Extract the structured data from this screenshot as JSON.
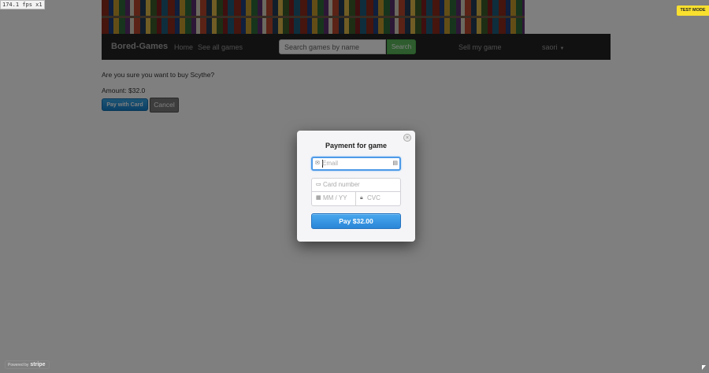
{
  "debug": {
    "fps_label": "174.1 fps x1"
  },
  "navbar": {
    "brand": "Bored-Games",
    "links": [
      "Home",
      "See all games"
    ],
    "search_placeholder": "Search games by name",
    "search_button": "Search",
    "sell_link": "Sell my game",
    "user_menu": "saori"
  },
  "purchase": {
    "question": "Are you sure you want to buy Scythe?",
    "amount": "Amount: $32.0",
    "pay_button": "Pay with Card",
    "cancel_button": "Cancel"
  },
  "checkout": {
    "title": "Payment for game",
    "email_placeholder": "Email",
    "card_number_placeholder": "Card number",
    "expiry_placeholder": "MM / YY",
    "cvc_placeholder": "CVC",
    "pay_button": "Pay $32.00",
    "test_mode_badge": "TEST MODE",
    "powered_by": "Powered by",
    "stripe": "stripe"
  },
  "icons": {
    "close": "close-icon",
    "email": "envelope-icon",
    "autofill": "contact-card-icon",
    "card": "credit-card-icon",
    "calendar": "calendar-icon",
    "lock": "lock-icon"
  },
  "colors": {
    "navbar": "#222222",
    "search_button": "#5cb85c",
    "pay_button": "#2a86d8",
    "test_mode": "#f9e02f",
    "focus_ring": "#4d9ae8"
  }
}
